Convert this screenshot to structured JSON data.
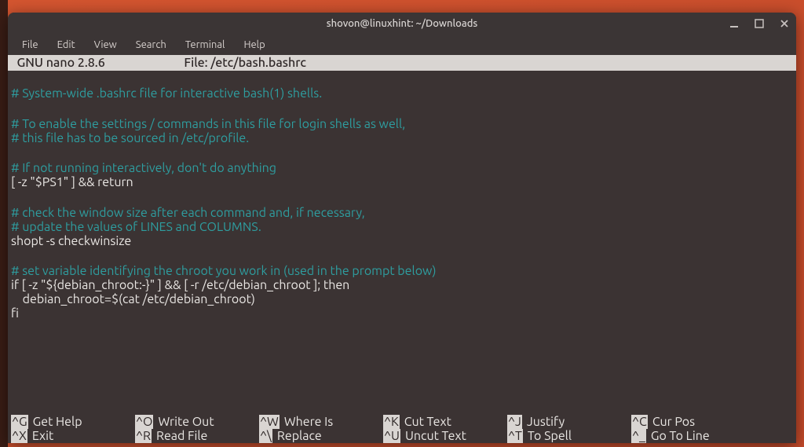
{
  "window": {
    "title": "shovon@linuxhint: ~/Downloads"
  },
  "menubar": {
    "items": [
      "File",
      "Edit",
      "View",
      "Search",
      "Terminal",
      "Help"
    ]
  },
  "nano": {
    "header_left": "  GNU nano 2.8.6",
    "header_center": "File: /etc/bash.bashrc",
    "lines": [
      {
        "type": "blank",
        "text": ""
      },
      {
        "type": "comment",
        "text": "# System-wide .bashrc file for interactive bash(1) shells."
      },
      {
        "type": "blank",
        "text": ""
      },
      {
        "type": "comment",
        "text": "# To enable the settings / commands in this file for login shells as well,"
      },
      {
        "type": "comment",
        "text": "# this file has to be sourced in /etc/profile."
      },
      {
        "type": "blank",
        "text": ""
      },
      {
        "type": "comment",
        "text": "# If not running interactively, don't do anything"
      },
      {
        "type": "plain",
        "text": "[ -z \"$PS1\" ] && return"
      },
      {
        "type": "blank",
        "text": ""
      },
      {
        "type": "comment",
        "text": "# check the window size after each command and, if necessary,"
      },
      {
        "type": "comment",
        "text": "# update the values of LINES and COLUMNS."
      },
      {
        "type": "plain",
        "text": "shopt -s checkwinsize"
      },
      {
        "type": "blank",
        "text": ""
      },
      {
        "type": "comment",
        "text": "# set variable identifying the chroot you work in (used in the prompt below)"
      },
      {
        "type": "plain",
        "text": "if [ -z \"${debian_chroot:-}\" ] && [ -r /etc/debian_chroot ]; then"
      },
      {
        "type": "plain",
        "text": "    debian_chroot=$(cat /etc/debian_chroot)"
      },
      {
        "type": "plain",
        "text": "fi"
      }
    ],
    "shortcuts": [
      [
        {
          "key": "^G",
          "label": "Get Help"
        },
        {
          "key": "^O",
          "label": "Write Out"
        },
        {
          "key": "^W",
          "label": "Where Is"
        },
        {
          "key": "^K",
          "label": "Cut Text"
        },
        {
          "key": "^J",
          "label": "Justify"
        },
        {
          "key": "^C",
          "label": "Cur Pos"
        }
      ],
      [
        {
          "key": "^X",
          "label": "Exit"
        },
        {
          "key": "^R",
          "label": "Read File"
        },
        {
          "key": "^\\",
          "label": "Replace"
        },
        {
          "key": "^U",
          "label": "Uncut Text"
        },
        {
          "key": "^T",
          "label": "To Spell"
        },
        {
          "key": "^_",
          "label": "Go To Line"
        }
      ]
    ]
  },
  "colors": {
    "terminal_bg": "#3b3333",
    "comment": "#2e9ea0",
    "plain": "#eae7e4",
    "inverse_bg": "#d9d5d2",
    "inverse_fg": "#2e2727"
  }
}
